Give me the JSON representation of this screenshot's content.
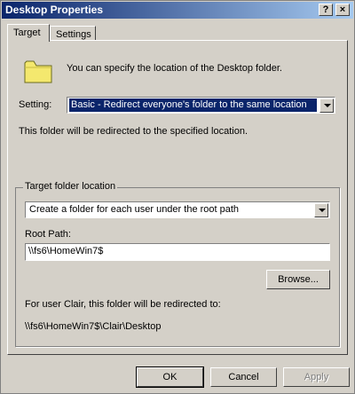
{
  "window": {
    "title": "Desktop Properties",
    "help_glyph": "?",
    "close_glyph": "×"
  },
  "tabs": [
    {
      "label": "Target",
      "active": true
    },
    {
      "label": "Settings",
      "active": false
    }
  ],
  "target": {
    "description": "You can specify the location of the Desktop folder.",
    "setting_label": "Setting:",
    "setting_value": "Basic - Redirect everyone's folder to the same location",
    "redirect_note": "This folder will be redirected to the specified location.",
    "group": {
      "label": "Target folder location",
      "location_option": "Create a folder for each user under the root path",
      "root_path_label": "Root Path:",
      "root_path_value": "\\\\fs6\\HomeWin7$",
      "browse_label": "Browse...",
      "preview_text": "For user Clair, this folder will be redirected to:",
      "preview_path": "\\\\fs6\\HomeWin7$\\Clair\\Desktop"
    }
  },
  "buttons": {
    "ok": "OK",
    "cancel": "Cancel",
    "apply": "Apply"
  },
  "colors": {
    "title_gradient_start": "#0a246a",
    "title_gradient_end": "#a6caf0",
    "dialog_bg": "#d4d0c8",
    "selection": "#0a246a",
    "folder_icon": "#f4e86e"
  }
}
